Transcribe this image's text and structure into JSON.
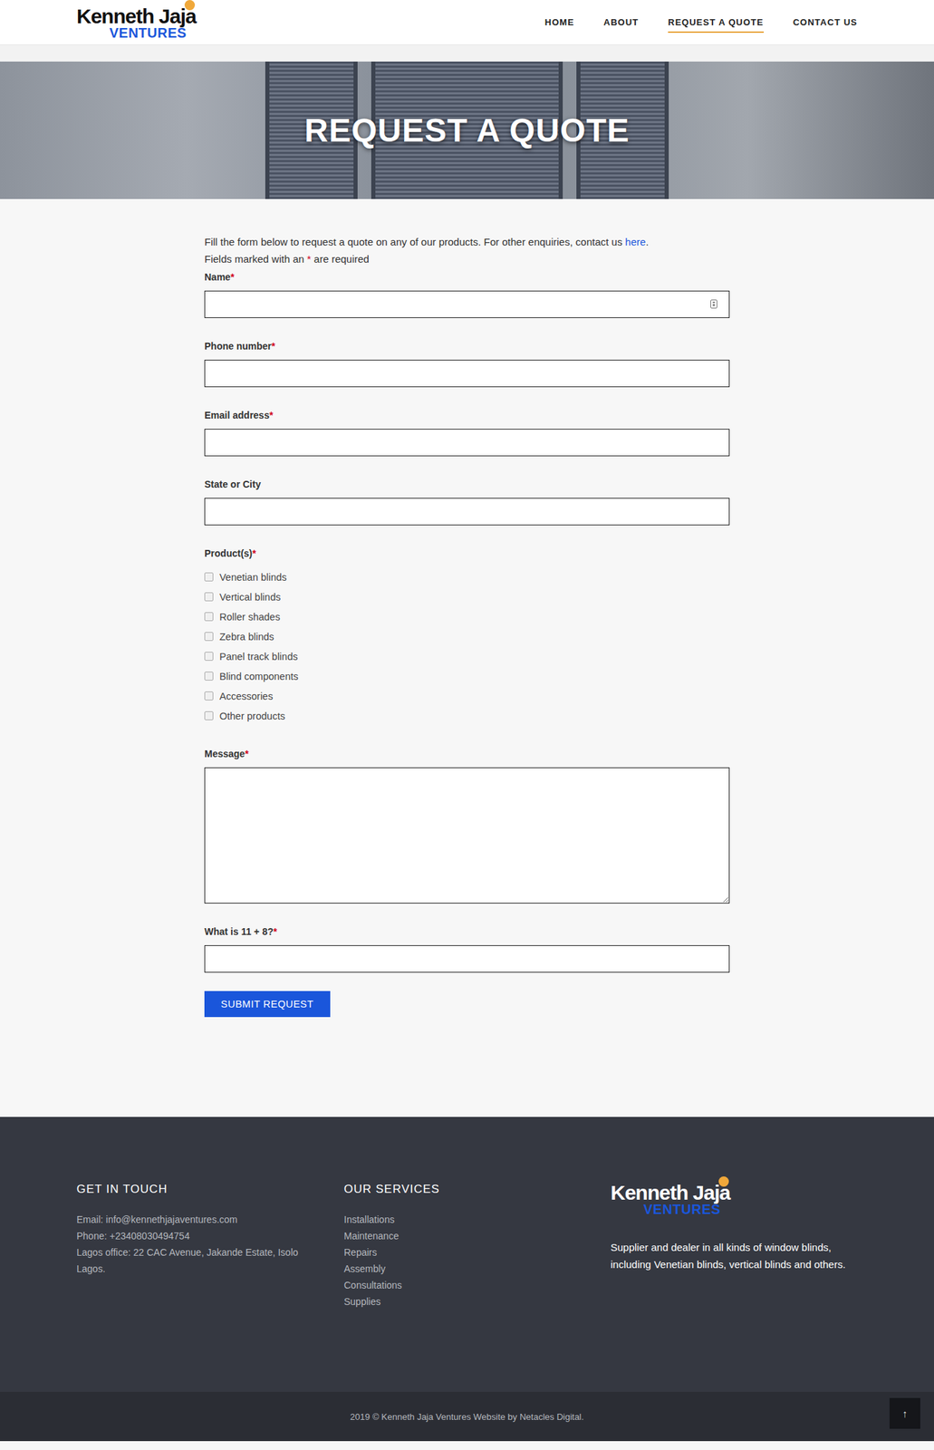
{
  "header": {
    "logo": {
      "name": "Kenneth Jaja",
      "sub": "VENTURES"
    },
    "nav": [
      {
        "label": "HOME",
        "selected": false
      },
      {
        "label": "ABOUT",
        "selected": false
      },
      {
        "label": "REQUEST A QUOTE",
        "selected": true
      },
      {
        "label": "CONTACT US",
        "selected": false
      }
    ]
  },
  "hero": {
    "title": "REQUEST A QUOTE"
  },
  "intro": {
    "text": "Fill the form below to request a quote on any of our products. For other enquiries, contact us ",
    "link": "here",
    "end": ".",
    "note_before": "Fields marked with an ",
    "note_mark": "*",
    "note_after": " are required"
  },
  "form": {
    "required_mark": "*",
    "fields": [
      {
        "kind": "text",
        "label": "Name",
        "required": true,
        "value": "",
        "autofill_icon": true
      },
      {
        "kind": "text",
        "label": "Phone number",
        "required": true,
        "value": "",
        "autofill_icon": false
      },
      {
        "kind": "text",
        "label": "Email address",
        "required": true,
        "value": "",
        "autofill_icon": false
      },
      {
        "kind": "text",
        "label": "State or City",
        "required": false,
        "value": "",
        "autofill_icon": false
      },
      {
        "kind": "checkboxes",
        "label": "Product(s)",
        "required": true,
        "options": [
          {
            "label": "Venetian blinds",
            "checked": false
          },
          {
            "label": "Vertical blinds",
            "checked": false
          },
          {
            "label": "Roller shades",
            "checked": false
          },
          {
            "label": "Zebra blinds",
            "checked": false
          },
          {
            "label": "Panel track blinds",
            "checked": false
          },
          {
            "label": "Blind components",
            "checked": false
          },
          {
            "label": "Accessories",
            "checked": false
          },
          {
            "label": "Other products",
            "checked": false
          }
        ]
      },
      {
        "kind": "textarea",
        "label": "Message",
        "required": true,
        "value": ""
      },
      {
        "kind": "text",
        "label": "What is 11 + 8?",
        "required": true,
        "value": "",
        "autofill_icon": false
      }
    ],
    "submit": "SUBMIT REQUEST"
  },
  "footer": {
    "contact": {
      "title": "GET IN TOUCH",
      "lines": [
        "Email: info@kennethjajaventures.com",
        "Phone: +23408030494754",
        "Lagos office: 22 CAC Avenue, Jakande Estate, Isolo Lagos."
      ]
    },
    "services": {
      "title": "OUR SERVICES",
      "items": [
        "Installations",
        "Maintenance",
        "Repairs",
        "Assembly",
        "Consultations",
        "Supplies"
      ]
    },
    "about": {
      "logo": {
        "name": "Kenneth Jaja",
        "sub": "VENTURES"
      },
      "text": "Supplier and dealer in all kinds of window blinds, including Venetian blinds, vertical blinds and others."
    },
    "copyright": "2019 © Kenneth Jaja Ventures Website by Netacles Digital.",
    "back_to_top": "↑"
  }
}
